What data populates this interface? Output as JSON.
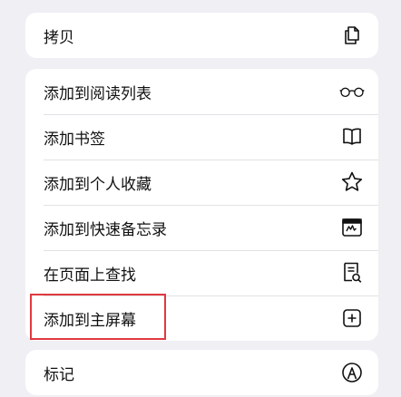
{
  "menu": {
    "group1": [
      {
        "label": "拷贝",
        "icon": "copy-icon"
      }
    ],
    "group2": [
      {
        "label": "添加到阅读列表",
        "icon": "glasses-icon"
      },
      {
        "label": "添加书签",
        "icon": "book-icon"
      },
      {
        "label": "添加到个人收藏",
        "icon": "star-icon"
      },
      {
        "label": "添加到快速备忘录",
        "icon": "quick-note-icon"
      },
      {
        "label": "在页面上查找",
        "icon": "find-on-page-icon"
      },
      {
        "label": "添加到主屏幕",
        "icon": "add-square-icon",
        "highlighted": true
      }
    ],
    "group3": [
      {
        "label": "标记",
        "icon": "markup-icon"
      }
    ]
  },
  "colors": {
    "background": "#efeff4",
    "highlight": "#e0393f"
  }
}
